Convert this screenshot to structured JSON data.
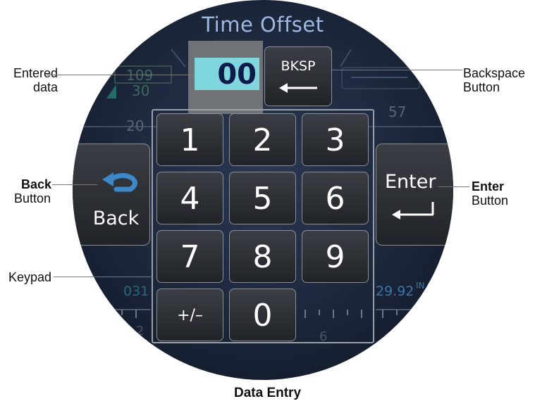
{
  "display": {
    "title": "Time Offset",
    "entered_value": "00",
    "backspace_label": "BKSP",
    "back_label": "Back",
    "enter_label": "Enter",
    "keypad": {
      "keys": [
        "1",
        "2",
        "3",
        "4",
        "5",
        "6",
        "7",
        "8",
        "9",
        "+/–",
        "0"
      ]
    },
    "background_labels": {
      "left_top": "109",
      "left_mid": "30",
      "left_low": "20",
      "right_mid": "57",
      "left_bottom": "031",
      "left_bottom2": "2",
      "right_bottom": "29.92",
      "right_bottom_unit": "IN",
      "bottom_center": "6"
    }
  },
  "callouts": {
    "entered_data": [
      "Entered",
      "data"
    ],
    "backspace": [
      "Backspace",
      "Button"
    ],
    "back_bold": "Back",
    "back_rest": "Button",
    "enter_bold": "Enter",
    "enter_rest": "Button",
    "keypad": "Keypad"
  },
  "caption": "Data Entry",
  "colors": {
    "entry_field": "#7fd6dc",
    "title": "#9fb8e2",
    "arrow_blue": "#3d88c8"
  }
}
